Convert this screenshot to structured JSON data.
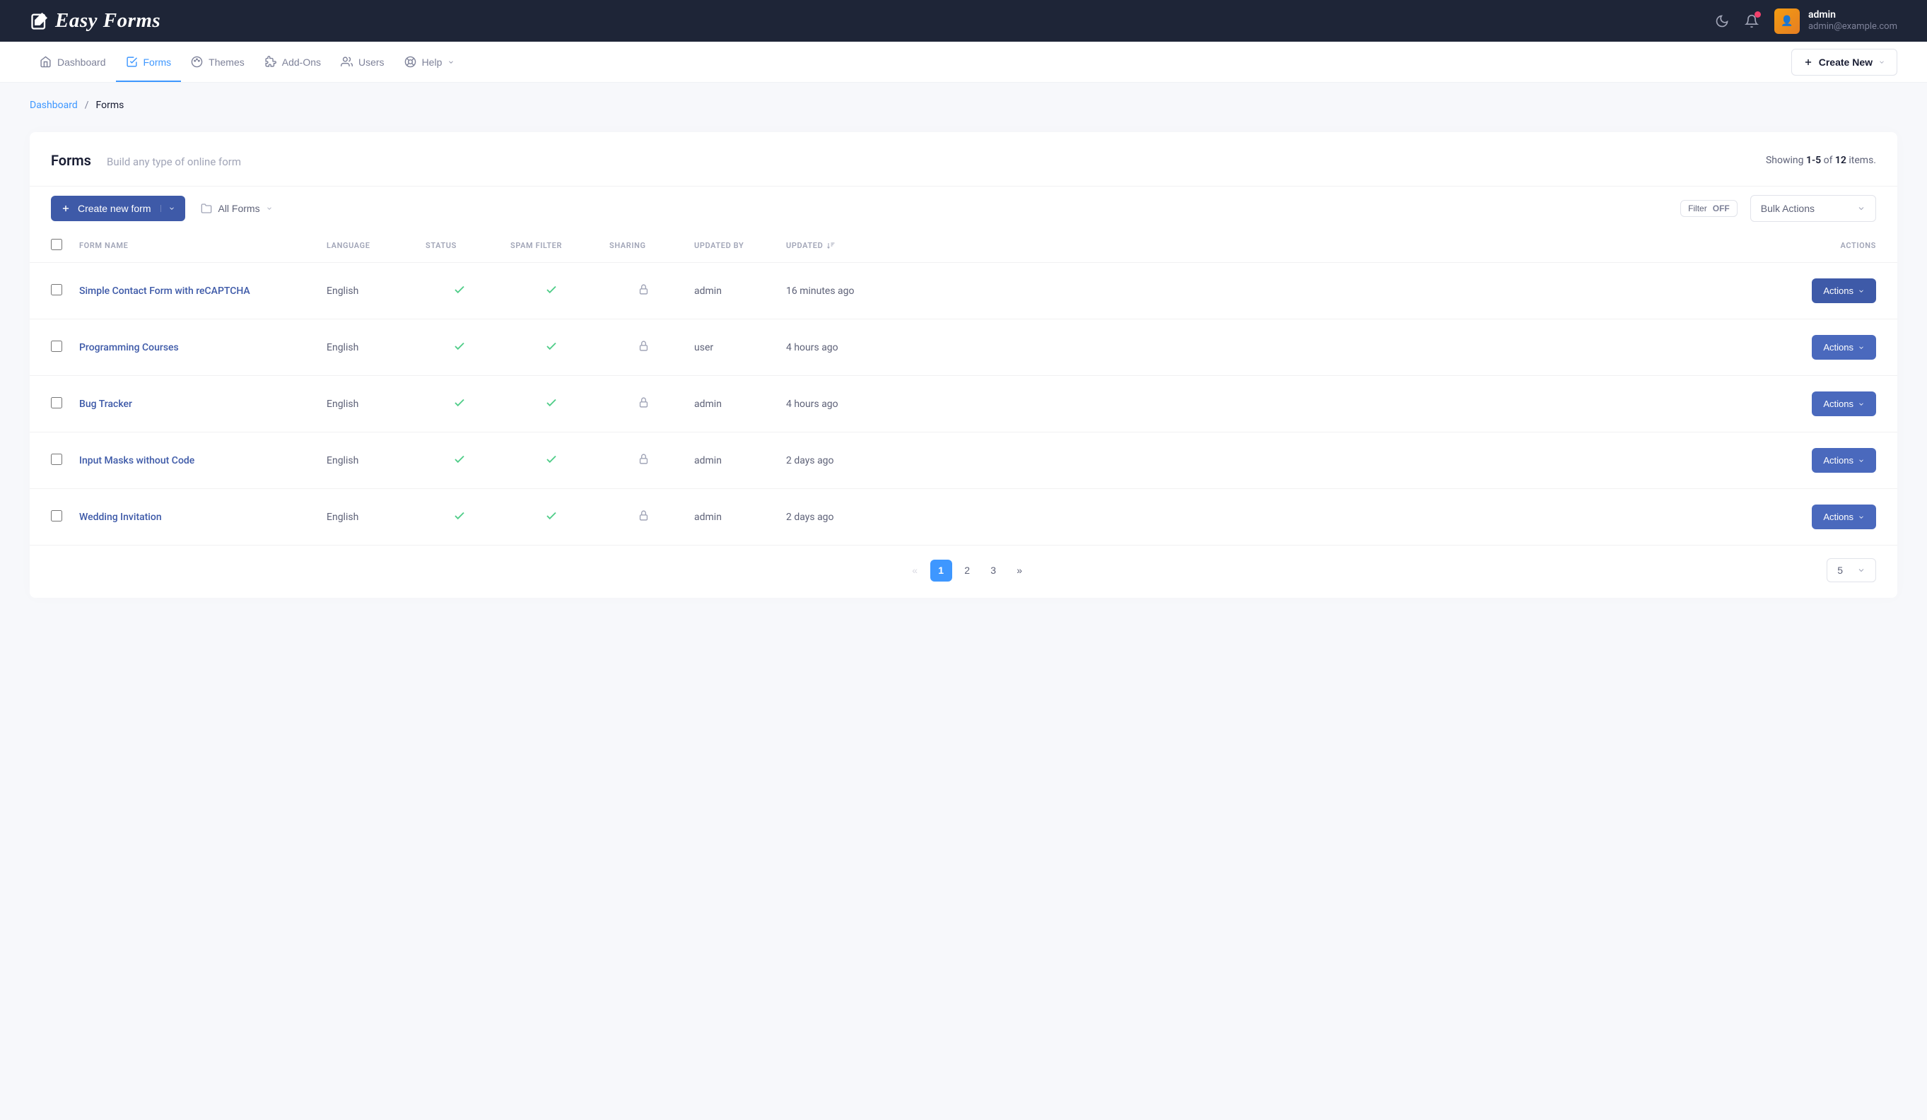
{
  "brand": "Easy Forms",
  "header": {
    "user_name": "admin",
    "user_email": "admin@example.com"
  },
  "nav": {
    "items": [
      {
        "label": "Dashboard",
        "icon": "home"
      },
      {
        "label": "Forms",
        "icon": "check-square",
        "active": true
      },
      {
        "label": "Themes",
        "icon": "palette"
      },
      {
        "label": "Add-Ons",
        "icon": "puzzle"
      },
      {
        "label": "Users",
        "icon": "users"
      },
      {
        "label": "Help",
        "icon": "lifebuoy",
        "caret": true
      }
    ],
    "create_new": "Create New"
  },
  "breadcrumb": {
    "link": "Dashboard",
    "current": "Forms"
  },
  "page": {
    "title": "Forms",
    "subtitle": "Build any type of online form",
    "summary_prefix": "Showing ",
    "summary_range": "1-5",
    "summary_of": " of ",
    "summary_total": "12",
    "summary_suffix": " items."
  },
  "toolbar": {
    "create_label": "Create new form",
    "folder_label": "All Forms",
    "filter_word": "Filter",
    "filter_state": "OFF",
    "bulk_label": "Bulk Actions"
  },
  "columns": {
    "name": "Form Name",
    "language": "Language",
    "status": "Status",
    "spam": "Spam Filter",
    "sharing": "Sharing",
    "updated_by": "Updated By",
    "updated": "Updated",
    "actions": "Actions"
  },
  "rows": [
    {
      "name": "Simple Contact Form with reCAPTCHA",
      "language": "English",
      "status": true,
      "spam": true,
      "sharing": "locked",
      "updated_by": "admin",
      "updated": "16 minutes ago"
    },
    {
      "name": "Programming Courses",
      "language": "English",
      "status": true,
      "spam": true,
      "sharing": "locked",
      "updated_by": "user",
      "updated": "4 hours ago"
    },
    {
      "name": "Bug Tracker",
      "language": "English",
      "status": true,
      "spam": true,
      "sharing": "locked",
      "updated_by": "admin",
      "updated": "4 hours ago"
    },
    {
      "name": "Input Masks without Code",
      "language": "English",
      "status": true,
      "spam": true,
      "sharing": "locked",
      "updated_by": "admin",
      "updated": "2 days ago"
    },
    {
      "name": "Wedding Invitation",
      "language": "English",
      "status": true,
      "spam": true,
      "sharing": "locked",
      "updated_by": "admin",
      "updated": "2 days ago"
    }
  ],
  "row_action_label": "Actions",
  "pagination": {
    "pages": [
      "1",
      "2",
      "3"
    ],
    "active": "1",
    "page_size": "5"
  }
}
